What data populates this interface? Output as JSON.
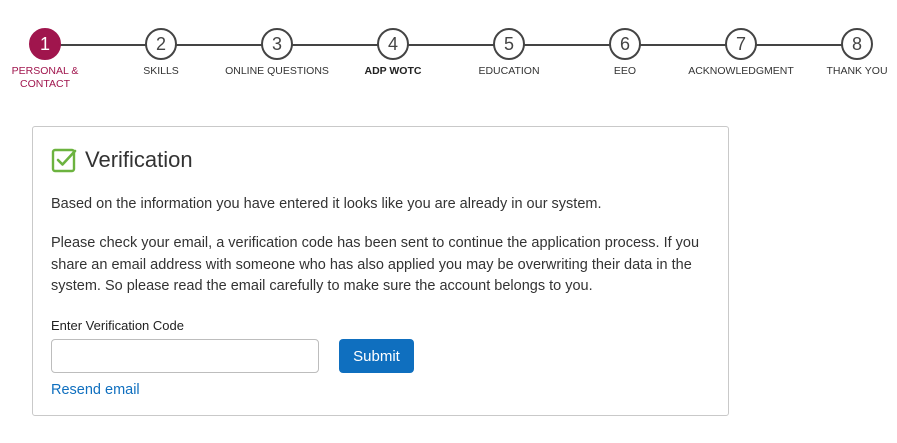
{
  "stepper": {
    "steps": [
      {
        "number": "1",
        "label": "PERSONAL & CONTACT",
        "state": "active"
      },
      {
        "number": "2",
        "label": "SKILLS",
        "state": "pending"
      },
      {
        "number": "3",
        "label": "ONLINE QUESTIONS",
        "state": "pending"
      },
      {
        "number": "4",
        "label": "ADP WOTC",
        "state": "pending"
      },
      {
        "number": "5",
        "label": "EDUCATION",
        "state": "pending"
      },
      {
        "number": "6",
        "label": "EEO",
        "state": "pending"
      },
      {
        "number": "7",
        "label": "ACKNOWLEDGMENT",
        "state": "pending"
      },
      {
        "number": "8",
        "label": "THANK YOU",
        "state": "pending"
      }
    ],
    "active_color": "#a0154d"
  },
  "verification": {
    "icon": "check-square-icon",
    "icon_color": "#6cb33f",
    "title": "Verification",
    "paragraph1": "Based on the information you have entered it looks like you are already in our system.",
    "paragraph2": "Please check your email, a verification code has been sent to continue the application process. If you share an email address with someone who has also applied you may be overwriting their data in the system. So please read the email carefully to make sure the account belongs to you.",
    "code_label": "Enter Verification Code",
    "code_value": "",
    "submit_label": "Submit",
    "resend_label": "Resend email",
    "accent_color": "#0f6fbf"
  }
}
